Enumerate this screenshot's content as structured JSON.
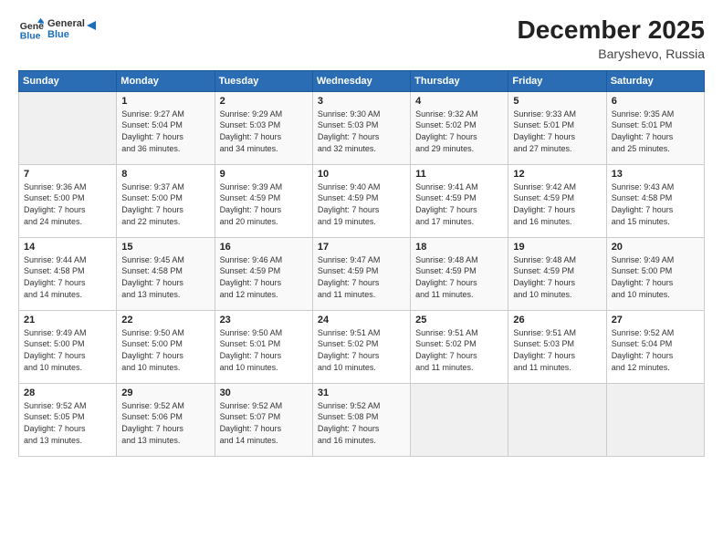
{
  "header": {
    "logo_line1": "General",
    "logo_line2": "Blue",
    "month": "December 2025",
    "location": "Baryshevo, Russia"
  },
  "weekdays": [
    "Sunday",
    "Monday",
    "Tuesday",
    "Wednesday",
    "Thursday",
    "Friday",
    "Saturday"
  ],
  "weeks": [
    [
      {
        "day": "",
        "info": ""
      },
      {
        "day": "1",
        "info": "Sunrise: 9:27 AM\nSunset: 5:04 PM\nDaylight: 7 hours\nand 36 minutes."
      },
      {
        "day": "2",
        "info": "Sunrise: 9:29 AM\nSunset: 5:03 PM\nDaylight: 7 hours\nand 34 minutes."
      },
      {
        "day": "3",
        "info": "Sunrise: 9:30 AM\nSunset: 5:03 PM\nDaylight: 7 hours\nand 32 minutes."
      },
      {
        "day": "4",
        "info": "Sunrise: 9:32 AM\nSunset: 5:02 PM\nDaylight: 7 hours\nand 29 minutes."
      },
      {
        "day": "5",
        "info": "Sunrise: 9:33 AM\nSunset: 5:01 PM\nDaylight: 7 hours\nand 27 minutes."
      },
      {
        "day": "6",
        "info": "Sunrise: 9:35 AM\nSunset: 5:01 PM\nDaylight: 7 hours\nand 25 minutes."
      }
    ],
    [
      {
        "day": "7",
        "info": "Sunrise: 9:36 AM\nSunset: 5:00 PM\nDaylight: 7 hours\nand 24 minutes."
      },
      {
        "day": "8",
        "info": "Sunrise: 9:37 AM\nSunset: 5:00 PM\nDaylight: 7 hours\nand 22 minutes."
      },
      {
        "day": "9",
        "info": "Sunrise: 9:39 AM\nSunset: 4:59 PM\nDaylight: 7 hours\nand 20 minutes."
      },
      {
        "day": "10",
        "info": "Sunrise: 9:40 AM\nSunset: 4:59 PM\nDaylight: 7 hours\nand 19 minutes."
      },
      {
        "day": "11",
        "info": "Sunrise: 9:41 AM\nSunset: 4:59 PM\nDaylight: 7 hours\nand 17 minutes."
      },
      {
        "day": "12",
        "info": "Sunrise: 9:42 AM\nSunset: 4:59 PM\nDaylight: 7 hours\nand 16 minutes."
      },
      {
        "day": "13",
        "info": "Sunrise: 9:43 AM\nSunset: 4:58 PM\nDaylight: 7 hours\nand 15 minutes."
      }
    ],
    [
      {
        "day": "14",
        "info": "Sunrise: 9:44 AM\nSunset: 4:58 PM\nDaylight: 7 hours\nand 14 minutes."
      },
      {
        "day": "15",
        "info": "Sunrise: 9:45 AM\nSunset: 4:58 PM\nDaylight: 7 hours\nand 13 minutes."
      },
      {
        "day": "16",
        "info": "Sunrise: 9:46 AM\nSunset: 4:59 PM\nDaylight: 7 hours\nand 12 minutes."
      },
      {
        "day": "17",
        "info": "Sunrise: 9:47 AM\nSunset: 4:59 PM\nDaylight: 7 hours\nand 11 minutes."
      },
      {
        "day": "18",
        "info": "Sunrise: 9:48 AM\nSunset: 4:59 PM\nDaylight: 7 hours\nand 11 minutes."
      },
      {
        "day": "19",
        "info": "Sunrise: 9:48 AM\nSunset: 4:59 PM\nDaylight: 7 hours\nand 10 minutes."
      },
      {
        "day": "20",
        "info": "Sunrise: 9:49 AM\nSunset: 5:00 PM\nDaylight: 7 hours\nand 10 minutes."
      }
    ],
    [
      {
        "day": "21",
        "info": "Sunrise: 9:49 AM\nSunset: 5:00 PM\nDaylight: 7 hours\nand 10 minutes."
      },
      {
        "day": "22",
        "info": "Sunrise: 9:50 AM\nSunset: 5:00 PM\nDaylight: 7 hours\nand 10 minutes."
      },
      {
        "day": "23",
        "info": "Sunrise: 9:50 AM\nSunset: 5:01 PM\nDaylight: 7 hours\nand 10 minutes."
      },
      {
        "day": "24",
        "info": "Sunrise: 9:51 AM\nSunset: 5:02 PM\nDaylight: 7 hours\nand 10 minutes."
      },
      {
        "day": "25",
        "info": "Sunrise: 9:51 AM\nSunset: 5:02 PM\nDaylight: 7 hours\nand 11 minutes."
      },
      {
        "day": "26",
        "info": "Sunrise: 9:51 AM\nSunset: 5:03 PM\nDaylight: 7 hours\nand 11 minutes."
      },
      {
        "day": "27",
        "info": "Sunrise: 9:52 AM\nSunset: 5:04 PM\nDaylight: 7 hours\nand 12 minutes."
      }
    ],
    [
      {
        "day": "28",
        "info": "Sunrise: 9:52 AM\nSunset: 5:05 PM\nDaylight: 7 hours\nand 13 minutes."
      },
      {
        "day": "29",
        "info": "Sunrise: 9:52 AM\nSunset: 5:06 PM\nDaylight: 7 hours\nand 13 minutes."
      },
      {
        "day": "30",
        "info": "Sunrise: 9:52 AM\nSunset: 5:07 PM\nDaylight: 7 hours\nand 14 minutes."
      },
      {
        "day": "31",
        "info": "Sunrise: 9:52 AM\nSunset: 5:08 PM\nDaylight: 7 hours\nand 16 minutes."
      },
      {
        "day": "",
        "info": ""
      },
      {
        "day": "",
        "info": ""
      },
      {
        "day": "",
        "info": ""
      }
    ]
  ]
}
